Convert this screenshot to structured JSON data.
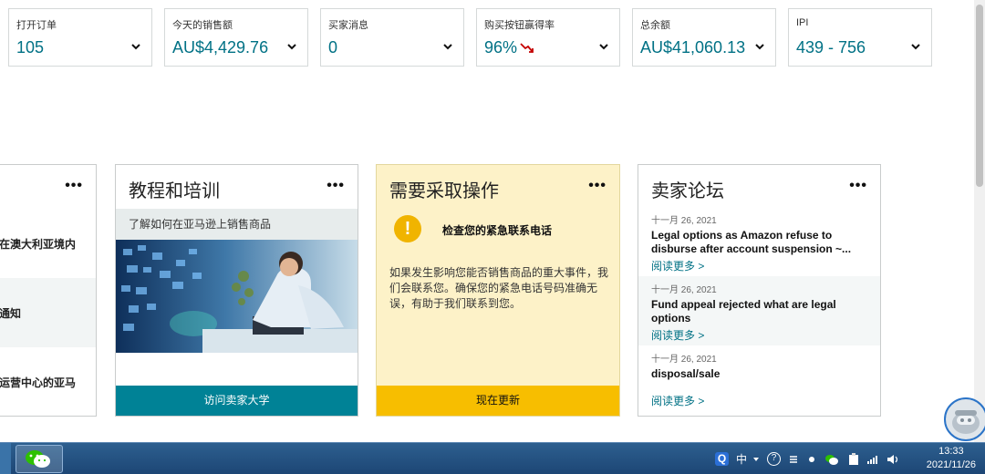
{
  "metrics": [
    {
      "label": "打开订单",
      "value": "105"
    },
    {
      "label": "今天的销售额",
      "value": "AU$4,429.76"
    },
    {
      "label": "买家消息",
      "value": "0"
    },
    {
      "label": "购买按钮赢得率",
      "value": "96%"
    },
    {
      "label": "总余额",
      "value": "AU$41,060.13"
    },
    {
      "label": "IPI",
      "value": "439 - 756"
    }
  ],
  "cards": {
    "left": {
      "dots": "•••",
      "rows": [
        "在澳大利亚境内",
        "通知",
        "运营中心的亚马"
      ]
    },
    "tutorial": {
      "title": "教程和培训",
      "dots": "•••",
      "subtitle": "了解如何在亚马逊上销售商品",
      "button": "访问卖家大学"
    },
    "action": {
      "title": "需要采取操作",
      "dots": "•••",
      "icon_glyph": "!",
      "heading": "检查您的紧急联系电话",
      "body": "如果发生影响您能否销售商品的重大事件，我们会联系您。确保您的紧急电话号码准确无误，有助于我们联系到您。",
      "button": "现在更新"
    },
    "forum": {
      "title": "卖家论坛",
      "dots": "•••",
      "posts": [
        {
          "date": "十一月 26, 2021",
          "title": "Legal options as Amazon refuse to disburse after account suspension ~...",
          "more": "阅读更多 >"
        },
        {
          "date": "十一月 26, 2021",
          "title": "Fund appeal rejected what are legal options",
          "more": "阅读更多 >"
        },
        {
          "date": "十一月 26, 2021",
          "title": "disposal/sale",
          "more": "阅读更多 >"
        }
      ]
    }
  },
  "taskbar": {
    "tray_q": "Q",
    "tray_lang": "中",
    "tray_help": "?",
    "time": "13:33",
    "date": "2021/11/26"
  },
  "colors": {
    "teal": "#008296",
    "link": "#007185",
    "action_bg": "#fdf2c8",
    "action_button": "#f7be00",
    "trend_down": "#c40000"
  }
}
